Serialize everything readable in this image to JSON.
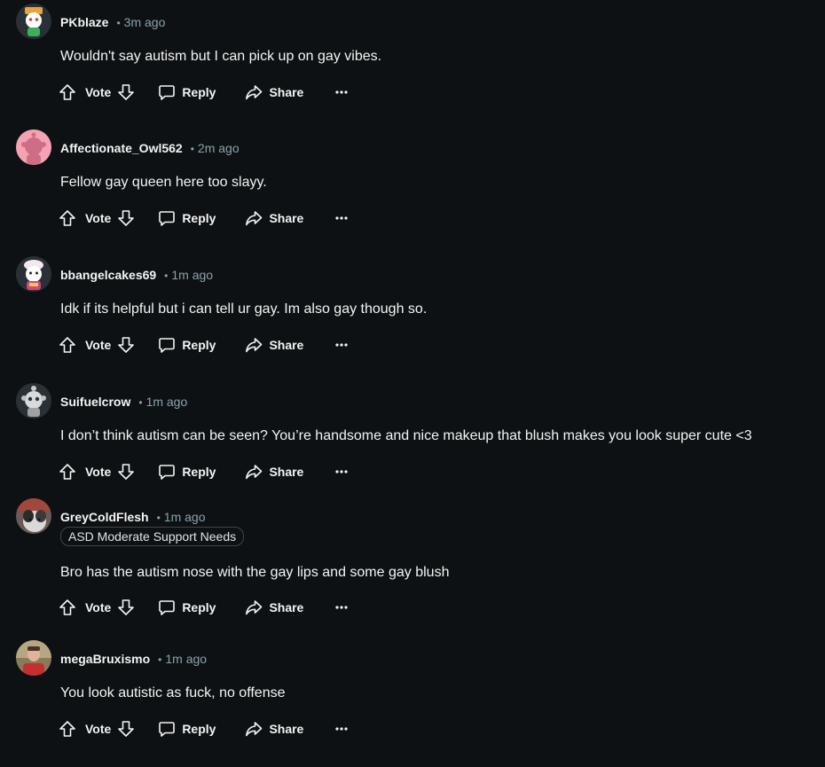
{
  "comments": [
    {
      "username": "PKblaze",
      "time": "3m ago",
      "flair": "",
      "text": "Wouldn't say autism but I can pick up on gay vibes.",
      "avatar_color": "#2a3136"
    },
    {
      "username": "Affectionate_Owl562",
      "time": "2m ago",
      "flair": "",
      "text": "Fellow gay queen here too slayy.",
      "avatar_color": "#f5a3b4"
    },
    {
      "username": "bbangelcakes69",
      "time": "1m ago",
      "flair": "",
      "text": "Idk if its helpful but i can tell ur gay. Im also gay though so.",
      "avatar_color": "#2a3136"
    },
    {
      "username": "Suifuelcrow",
      "time": "1m ago",
      "flair": "",
      "text": "I don’t think autism can be seen? You’re handsome and nice makeup that blush makes you look super cute <3",
      "avatar_color": "#2a3136"
    },
    {
      "username": "GreyColdFlesh",
      "time": "1m ago",
      "flair": "ASD Moderate Support Needs",
      "text": "Bro has the autism nose with the gay lips and some gay blush",
      "avatar_color": "#6b5a55"
    },
    {
      "username": "megaBruxismo",
      "time": "1m ago",
      "flair": "",
      "text": "You look autistic as fuck, no offense",
      "avatar_color": "#8a7a5c"
    }
  ],
  "actions": {
    "vote_label": "Vote",
    "reply_label": "Reply",
    "share_label": "Share",
    "more_label": "···"
  },
  "icons": {
    "upvote": "upvote-arrow-icon",
    "downvote": "downvote-arrow-icon",
    "reply": "comment-bubble-icon",
    "share": "share-arrow-icon",
    "more": "overflow-dots-icon"
  },
  "colors": {
    "background": "#0e1113",
    "text": "#f2f4f5",
    "muted": "#8ba2ad",
    "flair_border": "#3c4449"
  }
}
